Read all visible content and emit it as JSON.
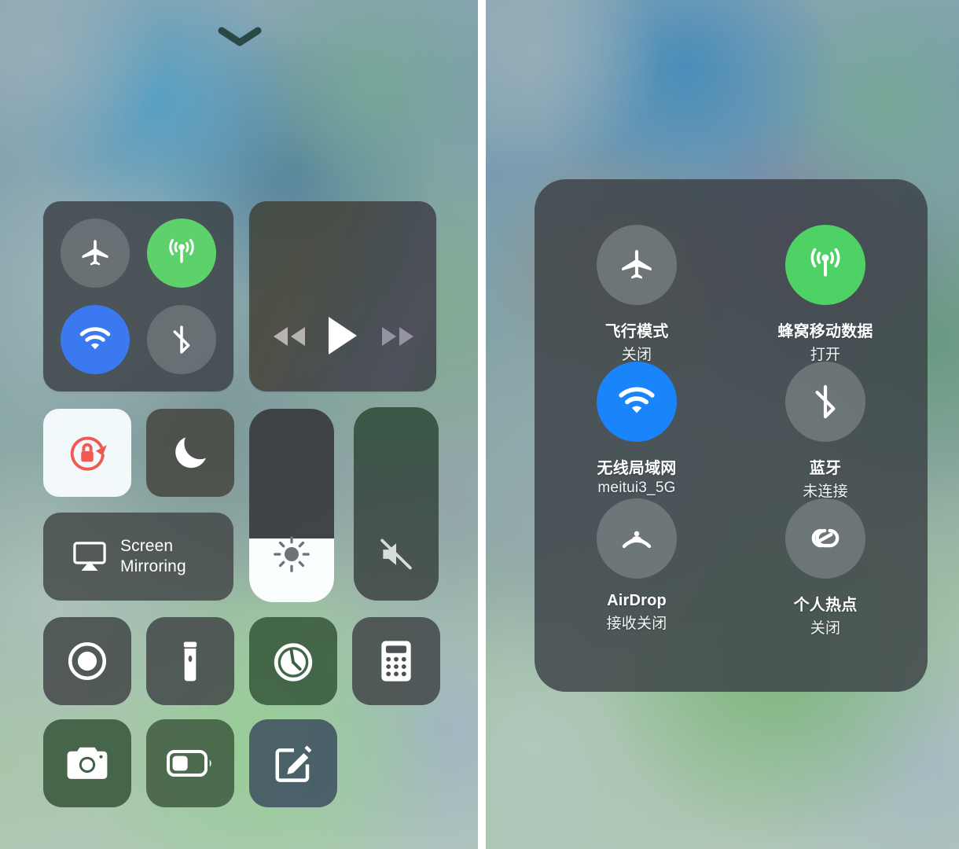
{
  "screens": {
    "left": {
      "name": "Control Center — compact"
    },
    "right": {
      "name": "Control Center — connectivity expanded"
    }
  },
  "left_panel": {
    "dismiss_chevron": "chevron-down",
    "connectivity": {
      "airplane": {
        "label": "airplane-mode",
        "state": "off",
        "color": "#82888c"
      },
      "cellular": {
        "label": "cellular-data",
        "state": "on",
        "color": "#5ed26a"
      },
      "wifi": {
        "label": "wifi",
        "state": "on",
        "color": "#3b79f0"
      },
      "bluetooth": {
        "label": "bluetooth",
        "state": "off",
        "color": "#82888c"
      }
    },
    "media": {
      "rewind": "rewind-button",
      "play": "play-button",
      "forward": "fast-forward-button",
      "state": "paused"
    },
    "rotation_lock": {
      "label": "rotation-lock",
      "state": "on",
      "icon_color": "#f05a52",
      "tile_color": "#f7fcfd"
    },
    "do_not_disturb": {
      "label": "do-not-disturb",
      "state": "off"
    },
    "screen_mirroring": {
      "line1": "Screen",
      "line2": "Mirroring"
    },
    "brightness": {
      "label": "brightness",
      "value_percent": 33
    },
    "volume": {
      "label": "volume",
      "value_percent": 0,
      "muted": true
    },
    "shortcuts_row1": [
      {
        "name": "screen-record",
        "icon": "record-icon",
        "tint": "dark"
      },
      {
        "name": "flashlight",
        "icon": "flashlight-icon",
        "tint": "dark"
      },
      {
        "name": "timer",
        "icon": "timer-icon",
        "tint": "green"
      },
      {
        "name": "calculator",
        "icon": "calculator-icon",
        "tint": "dark"
      }
    ],
    "shortcuts_row2": [
      {
        "name": "camera",
        "icon": "camera-icon",
        "tint": "green"
      },
      {
        "name": "low-power-mode",
        "icon": "battery-icon",
        "tint": "green2"
      },
      {
        "name": "notes",
        "icon": "notes-pencil-icon",
        "tint": "blue"
      }
    ]
  },
  "right_panel": {
    "items": [
      {
        "name": "airplane-mode",
        "icon": "airplane-icon",
        "title": "飞行模式",
        "subtitle": "关闭",
        "state": "off",
        "color": "#858c90"
      },
      {
        "name": "cellular-data",
        "icon": "cellular-icon",
        "title": "蜂窝移动数据",
        "subtitle": "打开",
        "state": "on",
        "color": "#5ed26a"
      },
      {
        "name": "wifi",
        "icon": "wifi-icon",
        "title": "无线局域网",
        "subtitle": "meitui3_5G",
        "state": "on",
        "color": "#1a84fa"
      },
      {
        "name": "bluetooth",
        "icon": "bluetooth-icon",
        "title": "蓝牙",
        "subtitle": "未连接",
        "state": "off",
        "color": "#8b9294"
      },
      {
        "name": "airdrop",
        "icon": "airdrop-icon",
        "title": "AirDrop",
        "subtitle": "接收关闭",
        "state": "off",
        "color": "#8b9294"
      },
      {
        "name": "personal-hotspot",
        "icon": "hotspot-icon",
        "title": "个人热点",
        "subtitle": "关闭",
        "state": "off",
        "color": "#8b9294"
      }
    ]
  }
}
